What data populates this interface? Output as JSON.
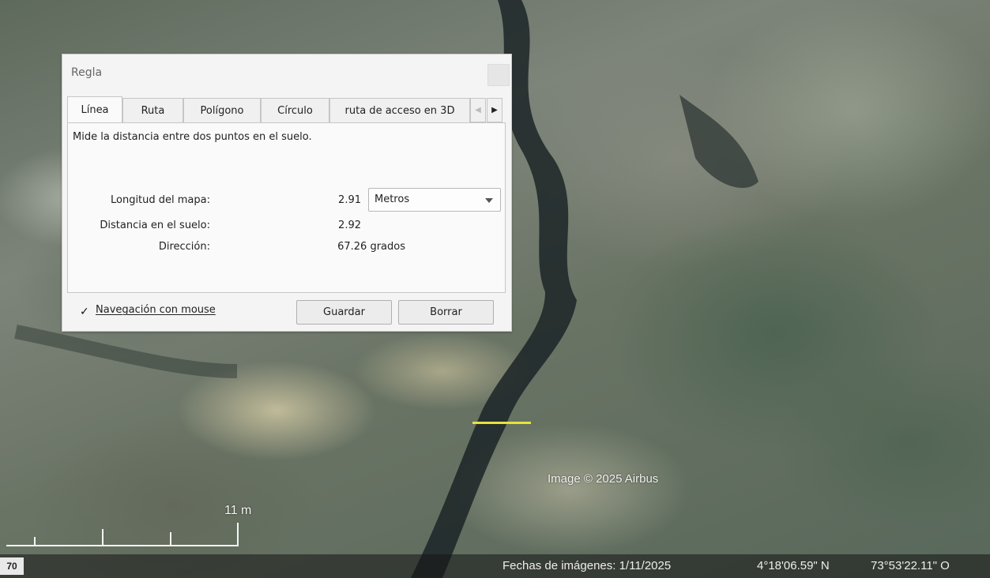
{
  "dialog": {
    "title": "Regla",
    "tabs": [
      "Línea",
      "Ruta",
      "Polígono",
      "Círculo",
      "ruta de acceso en 3D"
    ],
    "active_tab": "Línea",
    "description": "Mide la distancia entre dos puntos en el suelo.",
    "map_length_label": "Longitud del mapa:",
    "map_length_value": "2.91",
    "unit_selected": "Metros",
    "ground_distance_label": "Distancia en el suelo:",
    "ground_distance_value": "2.92",
    "heading_label": "Dirección:",
    "heading_value": "67.26 grados",
    "mouse_nav_label": "Navegación con mouse",
    "mouse_nav_checked": true,
    "check_glyph": "✓",
    "save_label": "Guardar",
    "clear_label": "Borrar"
  },
  "map": {
    "attribution": "Image © 2025 Airbus",
    "scale_label": "11 m",
    "measure_line_color": "#e8e23a"
  },
  "status": {
    "left_value": "70",
    "imagery_date": "Fechas de imágenes: 1/11/2025",
    "latitude": "4°18'06.59\" N",
    "longitude": "73°53'22.11\" O"
  }
}
